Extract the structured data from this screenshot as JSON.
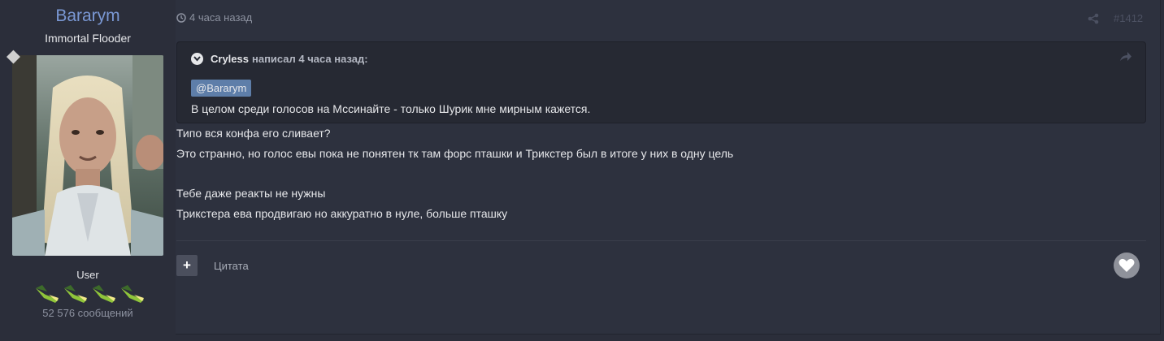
{
  "author": {
    "name": "Bararym",
    "title": "Immortal Flooder",
    "group": "User",
    "posts": "52 576 сообщений",
    "rank_pips": 4
  },
  "post": {
    "time": "4 часа назад",
    "number": "#1412",
    "quote": {
      "author": "Cryless",
      "suffix": "написал 4 часа назад:",
      "mention": "@Bararym",
      "text": "В целом среди голосов на Мссинайте - только Шурик мне мирным кажется."
    },
    "lines": [
      "Типо вся конфа его сливает?",
      "Это странно, но голос евы пока не понятен тк там форс пташки и Трикстер был в итоге у них в одну цель",
      "Тебе даже реакты не нужны",
      "Трикстера ева продвигаю но аккуратно в нуле, больше пташку"
    ],
    "actions": {
      "cite_label": "Цитата"
    }
  },
  "colors": {
    "background": "#2d313e",
    "author_name": "#7a98d4",
    "mention_bg": "#5e7ea9"
  },
  "icons": [
    "clock-icon",
    "share-icon",
    "quote-collapse-icon",
    "jump-arrow-icon",
    "plus-icon",
    "heart-icon",
    "rank-pip-icon"
  ]
}
